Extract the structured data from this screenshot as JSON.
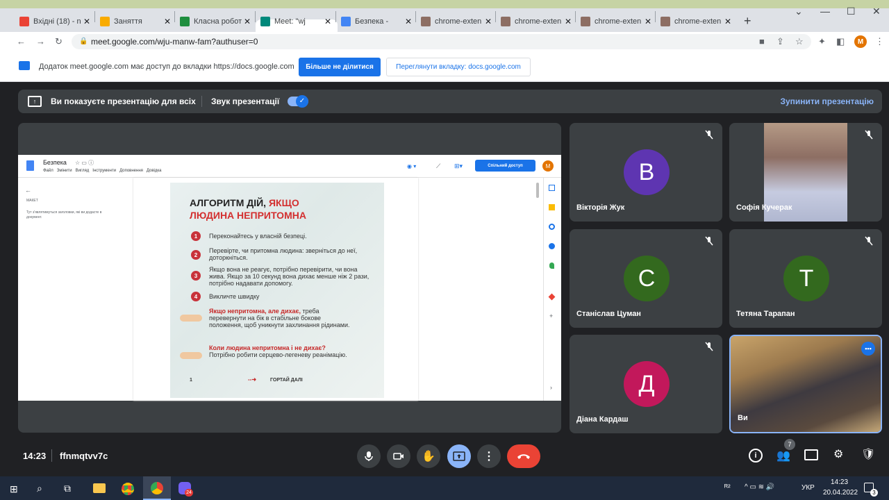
{
  "browser": {
    "tabs": [
      {
        "title": "Вхідні (18) - n",
        "icon": "gmail-icon",
        "color": "#ea4335"
      },
      {
        "title": "Заняття",
        "icon": "classroom-icon",
        "color": "#f9ab00"
      },
      {
        "title": "Класна робот",
        "icon": "classroom-icon",
        "color": "#1e8e3e"
      },
      {
        "title": "Meet: \"wj",
        "icon": "meet-icon",
        "color": "#00897b"
      },
      {
        "title": "Безпека -",
        "icon": "docs-icon",
        "color": "#4285f4"
      },
      {
        "title": "chrome-exten",
        "icon": "extension-icon",
        "color": "#8d6e63"
      },
      {
        "title": "chrome-exten",
        "icon": "extension-icon",
        "color": "#8d6e63"
      },
      {
        "title": "chrome-exten",
        "icon": "extension-icon",
        "color": "#8d6e63"
      },
      {
        "title": "chrome-exten",
        "icon": "extension-icon",
        "color": "#8d6e63"
      }
    ],
    "url": "meet.google.com/wju-manw-fam?authuser=0",
    "profile_initial": "M"
  },
  "share_bar": {
    "message": "Додаток meet.google.com має доступ до вкладки https://docs.google.com",
    "stop_button": "Більше не ділитися",
    "view_button": "Переглянути вкладку: docs.google.com"
  },
  "present_bar": {
    "presenting_text": "Ви показуєте презентацію для всіх",
    "audio_label": "Звук презентації",
    "stop_label": "Зупинити презентацію"
  },
  "doc": {
    "title": "Безпека",
    "menu": [
      "Файл",
      "Змінити",
      "Вигляд",
      "Інструменти",
      "Доповнення",
      "Довідка"
    ],
    "share_button": "Спільний доступ",
    "outline_title": "МАКЕТ",
    "outline_hint": "Тут з'являтимуться заголовки, які ви додасте в документ.",
    "poster": {
      "title_black": "АЛГОРИТМ ДІЙ, ",
      "title_red1": "ЯКЩО",
      "title_red2": "ЛЮДИНА НЕПРИТОМНА",
      "steps": [
        "Переконайтесь у власній безпеці.",
        "Перевірте, чи притомна людина: зверніться до неї, доторкніться.",
        "Якщо вона не реагує, потрібно перевірити, чи вона жива. Якщо за 10 секунд вона дихає менше ніж 2 рази, потрібно надавати допомогу.",
        "Викличте швидку"
      ],
      "note1_red": "Якщо непритомна, але дихає,",
      "note1_text": " треба перевернути на бік в стабільне бокове положення, щоб уникнути захлинання рідинами.",
      "note2_red": "Коли людина непритомна і не дихає?",
      "note2_text": "Потрібно робити серцево-легеневу реанімацію.",
      "page_no": "1",
      "next": "ГОРТАЙ ДАЛІ"
    }
  },
  "participants": [
    {
      "name": "Вікторія Жук",
      "initial": "В",
      "color": "#5e35b1",
      "video": false
    },
    {
      "name": "Софія Кучерак",
      "initial": "",
      "color": "#a1887f",
      "video": true
    },
    {
      "name": "Станіслав Цуман",
      "initial": "С",
      "color": "#33691e",
      "video": false
    },
    {
      "name": "Тетяна Тарапан",
      "initial": "Т",
      "color": "#33691e",
      "video": false
    },
    {
      "name": "Діана Кардаш",
      "initial": "Д",
      "color": "#c2185b",
      "video": false
    },
    {
      "name": "Ви",
      "initial": "",
      "color": "#6d5a4a",
      "video": true
    }
  ],
  "meeting": {
    "time": "14:23",
    "code": "ffnmqtvv7c",
    "people_count": "7"
  },
  "taskbar": {
    "badge": "24",
    "lang": "УКР",
    "clock_time": "14:23",
    "clock_date": "20.04.2022",
    "notifications": "3"
  }
}
